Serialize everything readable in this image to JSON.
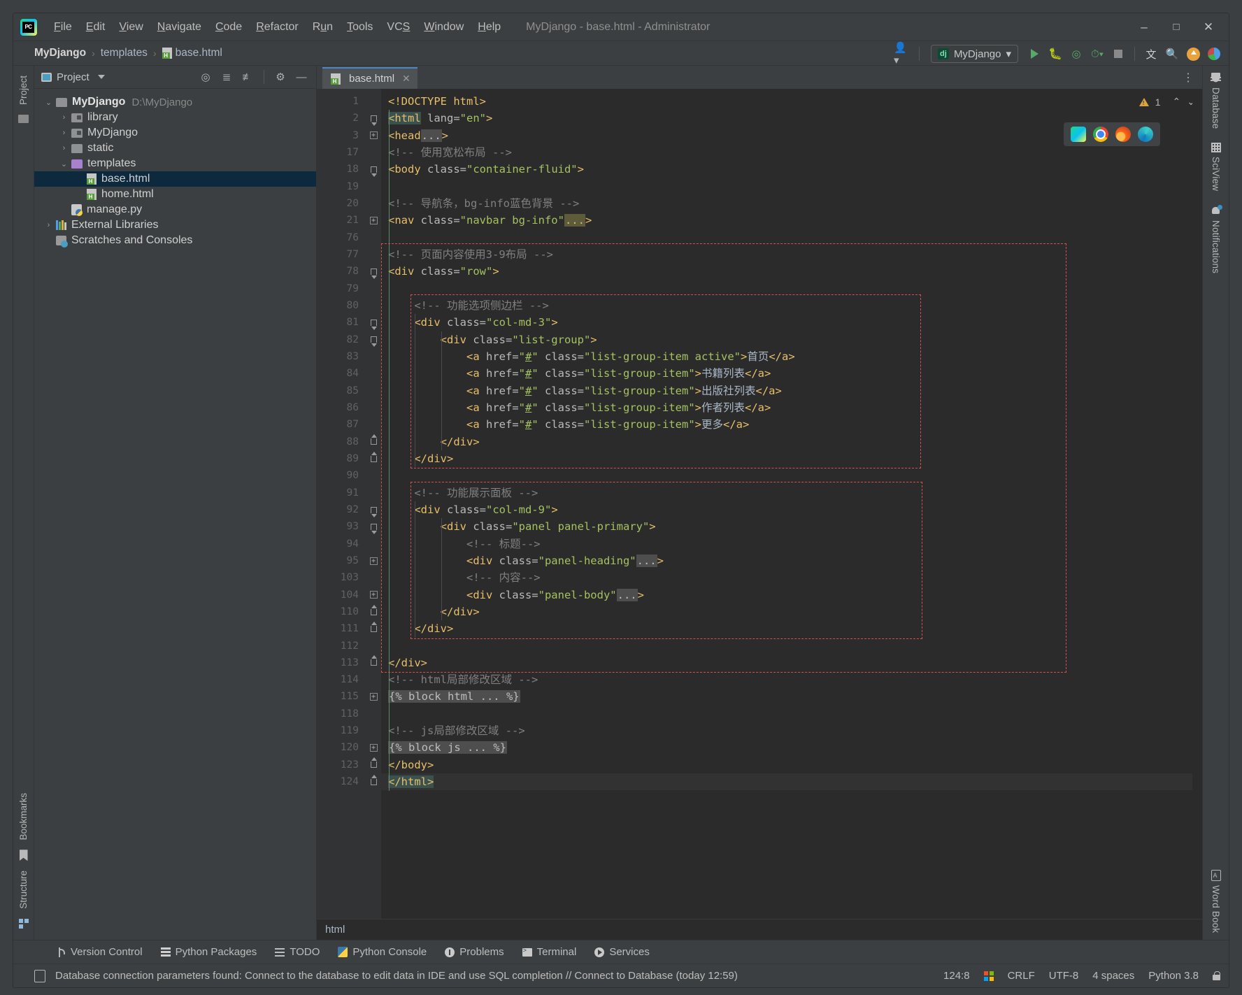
{
  "window": {
    "title": "MyDjango - base.html - Administrator",
    "logo_icon": "pycharm-logo-icon",
    "minimize_icon": "minimize-icon",
    "maximize_icon": "maximize-icon",
    "close_icon": "close-icon"
  },
  "menu": [
    {
      "label": "File",
      "mnemonic": "F"
    },
    {
      "label": "Edit",
      "mnemonic": "E"
    },
    {
      "label": "View",
      "mnemonic": "V"
    },
    {
      "label": "Navigate",
      "mnemonic": "N"
    },
    {
      "label": "Code",
      "mnemonic": "C"
    },
    {
      "label": "Refactor",
      "mnemonic": "R"
    },
    {
      "label": "Run",
      "mnemonic": "u"
    },
    {
      "label": "Tools",
      "mnemonic": "T"
    },
    {
      "label": "VCS",
      "mnemonic": "S"
    },
    {
      "label": "Window",
      "mnemonic": "W"
    },
    {
      "label": "Help",
      "mnemonic": "H"
    }
  ],
  "breadcrumb": {
    "project": "MyDjango",
    "folder": "templates",
    "file": "base.html",
    "separator": "›"
  },
  "navbar_right": {
    "user_icon": "user-avatar-icon",
    "run_config": "MyDjango",
    "run_config_icon": "django-icon",
    "run_icon": "run-play-icon",
    "debug_icon": "debug-bug-icon",
    "coverage_icon": "run-coverage-icon",
    "profile_icon": "profiler-icon",
    "stop_icon": "stop-icon",
    "translate_icon": "translate-icon",
    "search_icon": "search-icon",
    "update_icon": "update-arrow-icon",
    "ide_icon": "ide-eye-icon"
  },
  "left_strip": {
    "project_tab": "Project",
    "bookmarks_tab": "Bookmarks",
    "structure_tab": "Structure",
    "folder_icon": "folder-icon",
    "bookmark_icon": "bookmark-icon",
    "structure_icon": "structure-icon"
  },
  "project_panel": {
    "title": "Project",
    "panel_icon": "project-window-icon",
    "dropdown_icon": "chevron-down-icon",
    "locate_icon": "select-opened-file-icon",
    "expand_icon": "expand-all-icon",
    "collapse_icon": "collapse-all-icon",
    "settings_icon": "gear-icon",
    "hide_icon": "hide-icon",
    "tree": [
      {
        "label": "MyDjango",
        "path": "D:\\MyDjango",
        "icon": "folder-icon",
        "indent": 0,
        "arrow": "⌄",
        "bold": true,
        "selected": false
      },
      {
        "label": "library",
        "path": "",
        "icon": "module-folder-icon",
        "indent": 1,
        "arrow": "›",
        "bold": false,
        "selected": false
      },
      {
        "label": "MyDjango",
        "path": "",
        "icon": "module-folder-icon",
        "indent": 1,
        "arrow": "›",
        "bold": false,
        "selected": false
      },
      {
        "label": "static",
        "path": "",
        "icon": "folder-icon",
        "indent": 1,
        "arrow": "›",
        "bold": false,
        "selected": false
      },
      {
        "label": "templates",
        "path": "",
        "icon": "templates-folder-icon",
        "indent": 1,
        "arrow": "⌄",
        "bold": false,
        "selected": false
      },
      {
        "label": "base.html",
        "path": "",
        "icon": "html-file-icon",
        "indent": 2,
        "arrow": "",
        "bold": false,
        "selected": true
      },
      {
        "label": "home.html",
        "path": "",
        "icon": "html-file-icon",
        "indent": 2,
        "arrow": "",
        "bold": false,
        "selected": false
      },
      {
        "label": "manage.py",
        "path": "",
        "icon": "python-file-icon",
        "indent": 1,
        "arrow": "",
        "bold": false,
        "selected": false
      },
      {
        "label": "External Libraries",
        "path": "",
        "icon": "libraries-icon",
        "indent": 0,
        "arrow": "›",
        "bold": false,
        "selected": false
      },
      {
        "label": "Scratches and Consoles",
        "path": "",
        "icon": "scratches-icon",
        "indent": 0,
        "arrow": "",
        "bold": false,
        "selected": false
      }
    ]
  },
  "editor": {
    "tab_label": "base.html",
    "tab_icon": "html-file-icon",
    "tab_close_icon": "close-icon",
    "tab_options_icon": "more-options-icon",
    "warning_count": "1",
    "warning_icon": "warning-triangle-icon",
    "prev_problem_icon": "chevron-up-icon",
    "next_problem_icon": "chevron-down-icon",
    "browser_icons": [
      "pycharm-preview-icon",
      "chrome-icon",
      "firefox-icon",
      "edge-icon"
    ],
    "breadcrumb_bottom": "html",
    "lines": [
      {
        "num": "1",
        "indent": 0,
        "fold": "",
        "tokens": [
          {
            "c": "t",
            "x": "<!DOCTYPE html>"
          }
        ]
      },
      {
        "num": "2",
        "indent": 0,
        "fold": "open",
        "tokens": [
          {
            "c": "t mark",
            "x": "<html"
          },
          {
            "c": "at",
            "x": " lang="
          },
          {
            "c": "vl",
            "x": "\"en\""
          },
          {
            "c": "t",
            "x": ">"
          }
        ]
      },
      {
        "num": "3",
        "indent": 0,
        "fold": "plus",
        "tokens": [
          {
            "c": "t",
            "x": "<head"
          },
          {
            "c": "ellip",
            "x": "..."
          },
          {
            "c": "t",
            "x": ">"
          }
        ]
      },
      {
        "num": "17",
        "indent": 0,
        "fold": "",
        "tokens": [
          {
            "c": "cm",
            "x": "<!-- 使用宽松布局 -->"
          }
        ]
      },
      {
        "num": "18",
        "indent": 0,
        "fold": "open",
        "tokens": [
          {
            "c": "t",
            "x": "<body"
          },
          {
            "c": "at",
            "x": " class="
          },
          {
            "c": "vl",
            "x": "\"container-fluid\""
          },
          {
            "c": "t",
            "x": ">"
          }
        ]
      },
      {
        "num": "19",
        "indent": 0,
        "fold": "",
        "tokens": []
      },
      {
        "num": "20",
        "indent": 0,
        "fold": "",
        "tokens": [
          {
            "c": "cm",
            "x": "<!-- 导航条，bg-info蓝色背景 -->"
          }
        ]
      },
      {
        "num": "21",
        "indent": 0,
        "fold": "plus",
        "tokens": [
          {
            "c": "t",
            "x": "<nav"
          },
          {
            "c": "at",
            "x": " class="
          },
          {
            "c": "vl",
            "x": "\"navbar bg-info\""
          },
          {
            "c": "ellip-y",
            "x": "..."
          },
          {
            "c": "t",
            "x": ">"
          }
        ]
      },
      {
        "num": "76",
        "indent": 0,
        "fold": "",
        "tokens": []
      },
      {
        "num": "77",
        "indent": 0,
        "fold": "",
        "tokens": [
          {
            "c": "cm",
            "x": "<!-- 页面内容使用3-9布局 -->"
          }
        ]
      },
      {
        "num": "78",
        "indent": 0,
        "fold": "open",
        "tokens": [
          {
            "c": "t",
            "x": "<div"
          },
          {
            "c": "at",
            "x": " class="
          },
          {
            "c": "vl",
            "x": "\"row\""
          },
          {
            "c": "t",
            "x": ">"
          }
        ]
      },
      {
        "num": "79",
        "indent": 0,
        "fold": "",
        "tokens": []
      },
      {
        "num": "80",
        "indent": 1,
        "fold": "",
        "tokens": [
          {
            "c": "cm",
            "x": "<!-- 功能选项侧边栏 -->"
          }
        ]
      },
      {
        "num": "81",
        "indent": 1,
        "fold": "open",
        "tokens": [
          {
            "c": "t",
            "x": "<div"
          },
          {
            "c": "at",
            "x": " class="
          },
          {
            "c": "vl",
            "x": "\"col-md-3\""
          },
          {
            "c": "t",
            "x": ">"
          }
        ]
      },
      {
        "num": "82",
        "indent": 2,
        "fold": "open",
        "tokens": [
          {
            "c": "t",
            "x": "<div"
          },
          {
            "c": "at",
            "x": " class="
          },
          {
            "c": "vl",
            "x": "\"list-group\""
          },
          {
            "c": "t",
            "x": ">"
          }
        ]
      },
      {
        "num": "83",
        "indent": 3,
        "fold": "",
        "tokens": [
          {
            "c": "t",
            "x": "<a"
          },
          {
            "c": "at",
            "x": " href="
          },
          {
            "c": "vl",
            "x": "\""
          },
          {
            "c": "vl ul",
            "x": "#"
          },
          {
            "c": "vl",
            "x": "\""
          },
          {
            "c": "at",
            "x": " class="
          },
          {
            "c": "vl",
            "x": "\"list-group-item active\""
          },
          {
            "c": "t",
            "x": ">"
          },
          {
            "c": "txt",
            "x": "首页"
          },
          {
            "c": "t",
            "x": "</a>"
          }
        ]
      },
      {
        "num": "84",
        "indent": 3,
        "fold": "",
        "tokens": [
          {
            "c": "t",
            "x": "<a"
          },
          {
            "c": "at",
            "x": " href="
          },
          {
            "c": "vl",
            "x": "\""
          },
          {
            "c": "vl ul",
            "x": "#"
          },
          {
            "c": "vl",
            "x": "\""
          },
          {
            "c": "at",
            "x": " class="
          },
          {
            "c": "vl",
            "x": "\"list-group-item\""
          },
          {
            "c": "t",
            "x": ">"
          },
          {
            "c": "txt",
            "x": "书籍列表"
          },
          {
            "c": "t",
            "x": "</a>"
          }
        ]
      },
      {
        "num": "85",
        "indent": 3,
        "fold": "",
        "tokens": [
          {
            "c": "t",
            "x": "<a"
          },
          {
            "c": "at",
            "x": " href="
          },
          {
            "c": "vl",
            "x": "\""
          },
          {
            "c": "vl ul",
            "x": "#"
          },
          {
            "c": "vl",
            "x": "\""
          },
          {
            "c": "at",
            "x": " class="
          },
          {
            "c": "vl",
            "x": "\"list-group-item\""
          },
          {
            "c": "t",
            "x": ">"
          },
          {
            "c": "txt",
            "x": "出版社列表"
          },
          {
            "c": "t",
            "x": "</a>"
          }
        ]
      },
      {
        "num": "86",
        "indent": 3,
        "fold": "",
        "tokens": [
          {
            "c": "t",
            "x": "<a"
          },
          {
            "c": "at",
            "x": " href="
          },
          {
            "c": "vl",
            "x": "\""
          },
          {
            "c": "vl ul",
            "x": "#"
          },
          {
            "c": "vl",
            "x": "\""
          },
          {
            "c": "at",
            "x": " class="
          },
          {
            "c": "vl",
            "x": "\"list-group-item\""
          },
          {
            "c": "t",
            "x": ">"
          },
          {
            "c": "txt",
            "x": "作者列表"
          },
          {
            "c": "t",
            "x": "</a>"
          }
        ]
      },
      {
        "num": "87",
        "indent": 3,
        "fold": "",
        "tokens": [
          {
            "c": "t",
            "x": "<a"
          },
          {
            "c": "at",
            "x": " href="
          },
          {
            "c": "vl",
            "x": "\""
          },
          {
            "c": "vl ul",
            "x": "#"
          },
          {
            "c": "vl",
            "x": "\""
          },
          {
            "c": "at",
            "x": " class="
          },
          {
            "c": "vl",
            "x": "\"list-group-item\""
          },
          {
            "c": "t",
            "x": ">"
          },
          {
            "c": "txt",
            "x": "更多"
          },
          {
            "c": "t",
            "x": "</a>"
          }
        ]
      },
      {
        "num": "88",
        "indent": 2,
        "fold": "close",
        "tokens": [
          {
            "c": "t",
            "x": "</div>"
          }
        ]
      },
      {
        "num": "89",
        "indent": 1,
        "fold": "close",
        "tokens": [
          {
            "c": "t",
            "x": "</div>"
          }
        ]
      },
      {
        "num": "90",
        "indent": 0,
        "fold": "",
        "tokens": []
      },
      {
        "num": "91",
        "indent": 1,
        "fold": "",
        "tokens": [
          {
            "c": "cm",
            "x": "<!-- 功能展示面板 -->"
          }
        ]
      },
      {
        "num": "92",
        "indent": 1,
        "fold": "open",
        "tokens": [
          {
            "c": "t",
            "x": "<div"
          },
          {
            "c": "at",
            "x": " class="
          },
          {
            "c": "vl",
            "x": "\"col-md-9\""
          },
          {
            "c": "t",
            "x": ">"
          }
        ]
      },
      {
        "num": "93",
        "indent": 2,
        "fold": "open",
        "tokens": [
          {
            "c": "t",
            "x": "<div"
          },
          {
            "c": "at",
            "x": " class="
          },
          {
            "c": "vl",
            "x": "\"panel panel-primary\""
          },
          {
            "c": "t",
            "x": ">"
          }
        ]
      },
      {
        "num": "94",
        "indent": 3,
        "fold": "",
        "tokens": [
          {
            "c": "cm",
            "x": "<!-- 标题-->"
          }
        ]
      },
      {
        "num": "95",
        "indent": 3,
        "fold": "plus",
        "tokens": [
          {
            "c": "t",
            "x": "<div"
          },
          {
            "c": "at",
            "x": " class="
          },
          {
            "c": "vl",
            "x": "\"panel-heading\""
          },
          {
            "c": "ellip",
            "x": "..."
          },
          {
            "c": "t",
            "x": ">"
          }
        ]
      },
      {
        "num": "103",
        "indent": 3,
        "fold": "",
        "tokens": [
          {
            "c": "cm",
            "x": "<!-- 内容-->"
          }
        ]
      },
      {
        "num": "104",
        "indent": 3,
        "fold": "plus",
        "tokens": [
          {
            "c": "t",
            "x": "<div"
          },
          {
            "c": "at",
            "x": " class="
          },
          {
            "c": "vl",
            "x": "\"panel-body\""
          },
          {
            "c": "ellip",
            "x": "..."
          },
          {
            "c": "t",
            "x": ">"
          }
        ]
      },
      {
        "num": "110",
        "indent": 2,
        "fold": "close",
        "tokens": [
          {
            "c": "t",
            "x": "</div>"
          }
        ]
      },
      {
        "num": "111",
        "indent": 1,
        "fold": "close",
        "tokens": [
          {
            "c": "t",
            "x": "</div>"
          }
        ]
      },
      {
        "num": "112",
        "indent": 0,
        "fold": "",
        "tokens": []
      },
      {
        "num": "113",
        "indent": 0,
        "fold": "close",
        "tokens": [
          {
            "c": "t",
            "x": "</div>"
          }
        ]
      },
      {
        "num": "114",
        "indent": 0,
        "fold": "",
        "tokens": [
          {
            "c": "cm",
            "x": "<!-- html局部修改区域 -->"
          }
        ]
      },
      {
        "num": "115",
        "indent": 0,
        "fold": "plus",
        "tokens": [
          {
            "c": "dj ellip",
            "x": "{% block html ... %}"
          }
        ]
      },
      {
        "num": "118",
        "indent": 0,
        "fold": "",
        "tokens": []
      },
      {
        "num": "119",
        "indent": 0,
        "fold": "",
        "tokens": [
          {
            "c": "cm",
            "x": "<!-- js局部修改区域 -->"
          }
        ]
      },
      {
        "num": "120",
        "indent": 0,
        "fold": "plus",
        "tokens": [
          {
            "c": "dj ellip",
            "x": "{% block js ... %}"
          }
        ]
      },
      {
        "num": "123",
        "indent": 0,
        "fold": "close",
        "tokens": [
          {
            "c": "t",
            "x": "</body>"
          }
        ]
      },
      {
        "num": "124",
        "indent": 0,
        "fold": "close",
        "tokens": [
          {
            "c": "t mark",
            "x": "</html>"
          }
        ],
        "current": true
      }
    ]
  },
  "right_strip": {
    "database_tab": "Database",
    "sciview_tab": "SciView",
    "notifications_tab": "Notifications",
    "wordbook_tab": "Word Book",
    "database_icon": "database-icon",
    "sciview_icon": "sciview-grid-icon",
    "notifications_icon": "bell-icon",
    "wordbook_icon": "book-icon"
  },
  "bottom_tools": [
    {
      "label": "Version Control",
      "icon": "version-control-icon"
    },
    {
      "label": "Python Packages",
      "icon": "packages-icon"
    },
    {
      "label": "TODO",
      "icon": "todo-list-icon"
    },
    {
      "label": "Python Console",
      "icon": "python-console-icon"
    },
    {
      "label": "Problems",
      "icon": "problems-icon"
    },
    {
      "label": "Terminal",
      "icon": "terminal-icon"
    },
    {
      "label": "Services",
      "icon": "services-icon"
    }
  ],
  "status_bar": {
    "message_icon": "notification-note-icon",
    "message": "Database connection parameters found: Connect to the database to edit data in IDE and use SQL completion // Connect to Database (today 12:59)",
    "caret_position": "124:8",
    "os_icon": "windows-icon",
    "line_separator": "CRLF",
    "encoding": "UTF-8",
    "indent": "4 spaces",
    "interpreter": "Python 3.8",
    "lock_icon": "lock-icon"
  }
}
